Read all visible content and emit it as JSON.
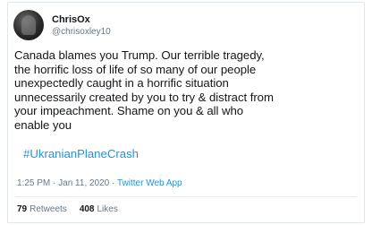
{
  "author": {
    "display_name": "ChrisOx",
    "handle": "@chrisoxley10",
    "avatar_icon": "profile-photo"
  },
  "tweet": {
    "text": "Canada blames you Trump. Our terrible tragedy,\nthe horrific loss of life of so many of our people\nunexpectedly caught in a horrific situation\nunnecessarily created by you to try & distract from\nyour impeachment. Shame on you & all who\nenable you",
    "hashtag": "#UkranianPlaneCrash",
    "time": "1:25 PM",
    "date": "Jan 11, 2020",
    "separator": "·",
    "source": "Twitter Web App"
  },
  "stats": {
    "retweets_count": "79",
    "retweets_label": "Retweets",
    "likes_count": "408",
    "likes_label": "Likes"
  },
  "colors": {
    "link": "#1b95e0",
    "secondary_text": "#657786",
    "primary_text": "#14171a"
  }
}
